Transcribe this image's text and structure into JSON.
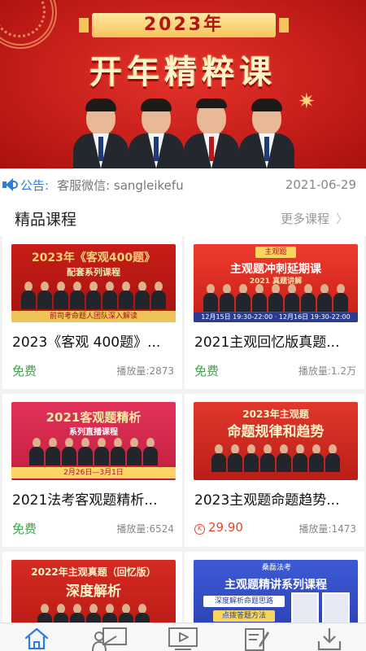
{
  "banner": {
    "year_label": "2023年",
    "title": "开年精粹课"
  },
  "notice": {
    "label": "公告:",
    "text": "客服微信: sangleikefu",
    "date": "2021-06-29"
  },
  "section": {
    "title": "精品课程",
    "more_label": "更多课程"
  },
  "courses": [
    {
      "title": "2023《客观 400题》...",
      "price": "免费",
      "plays": "播放量:2873",
      "thumb": {
        "title": "2023年《客观400题》",
        "subtitle": "配套系列课程",
        "strip": "前司考命题人团队深入解读",
        "colors": [
          "#c81d18",
          "#f0c25a"
        ]
      }
    },
    {
      "title": "2021主观回忆版真题...",
      "price": "免费",
      "plays": "播放量:1.2万",
      "thumb": {
        "badge": "主观题",
        "title": "主观题冲刺延期课",
        "subtitle": "2021 真题讲解",
        "strip": "12月15日 19:30-22:00 · 12月16日 19:30-22:00",
        "colors": [
          "#e8362c",
          "#ffffff"
        ]
      }
    },
    {
      "title": "2021法考客观题精析...",
      "price": "免费",
      "plays": "播放量:6524",
      "thumb": {
        "title": "2021客观题精析",
        "subtitle": "系列直播课程",
        "strip": "2月26日—3月1日",
        "colors": [
          "#d8284a",
          "#ffe9a8"
        ]
      }
    },
    {
      "title": "2023主观题命题趋势...",
      "price": "29.90",
      "plays": "播放量:1473",
      "thumb": {
        "title": "2023年主观题",
        "subtitle": "命题规律和趋势",
        "colors": [
          "#d12a22",
          "#fff1c8"
        ]
      }
    },
    {
      "title": "",
      "price": "",
      "plays": "",
      "thumb": {
        "title": "2022年主观真题（回忆版）",
        "subtitle": "深度解析",
        "colors": [
          "#cf231d",
          "#fff1c8"
        ]
      }
    },
    {
      "title": "",
      "price": "",
      "plays": "",
      "thumb": {
        "badge": "桑磊法考",
        "title": "主观题精讲系列课程",
        "subtitle": "深度解析命题思路",
        "subtitle2": "点拨答题方法",
        "colors": [
          "#3350c9",
          "#ffffff"
        ]
      }
    }
  ],
  "nav": [
    {
      "icon": "home-icon",
      "active": true
    },
    {
      "icon": "live-class-icon",
      "active": false
    },
    {
      "icon": "video-play-icon",
      "active": false
    },
    {
      "icon": "notes-edit-icon",
      "active": false
    },
    {
      "icon": "download-icon",
      "active": false
    }
  ]
}
